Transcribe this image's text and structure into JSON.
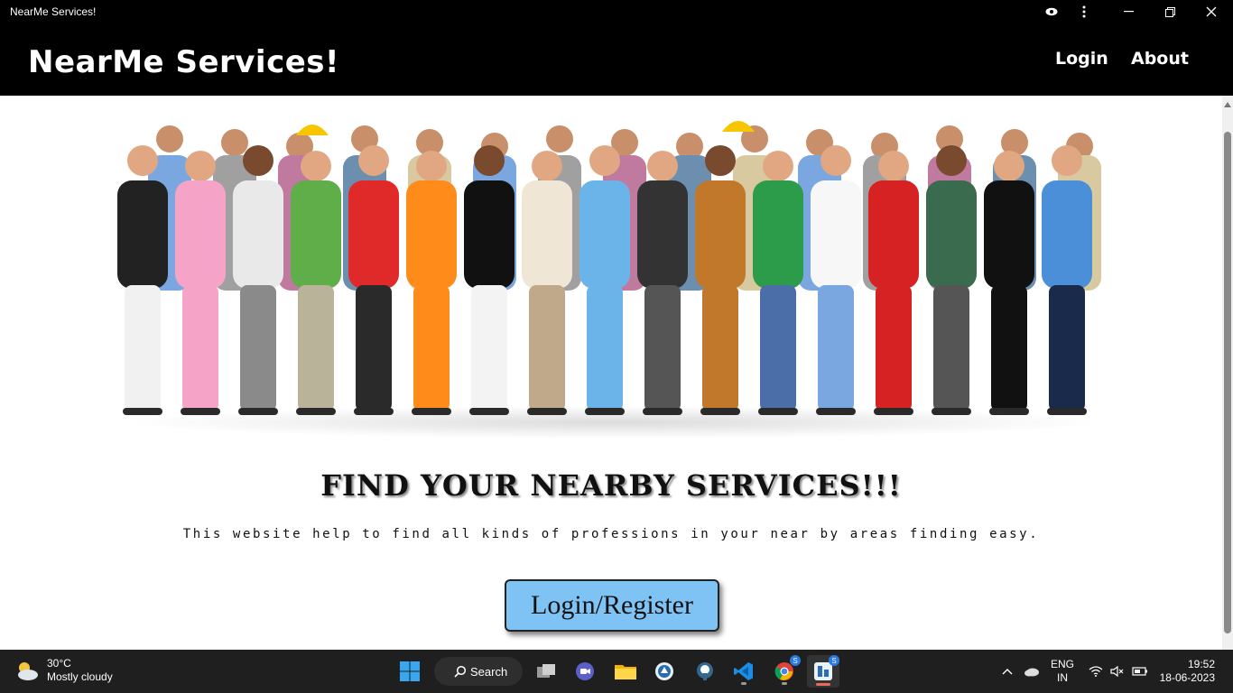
{
  "window": {
    "title": "NearMe Services!"
  },
  "navbar": {
    "brand": "NearMe Services!",
    "links": [
      "Login",
      "About"
    ]
  },
  "hero": {
    "image_description_icon": "group-of-professionals-image"
  },
  "main": {
    "headline": "FIND YOUR NEARBY SERVICES!!!",
    "tagline": "This website help to find all kinds of professions in your near by areas finding easy.",
    "cta_label": "Login/Register"
  },
  "colors": {
    "navbar_bg": "#000000",
    "cta_bg": "#7fc3f4",
    "taskbar_bg": "#1f1f1f"
  },
  "taskbar": {
    "weather": {
      "temp": "30°C",
      "condition": "Mostly cloudy"
    },
    "search_label": "Search",
    "apps": [
      "start-icon",
      "search-icon",
      "task-view-icon",
      "meet-icon",
      "file-explorer-icon",
      "app-icon",
      "postgres-icon",
      "vscode-icon",
      "chrome-icon",
      "app-active-icon"
    ],
    "language": {
      "line1": "ENG",
      "line2": "IN"
    },
    "time": "19:52",
    "date": "18-06-2023"
  }
}
